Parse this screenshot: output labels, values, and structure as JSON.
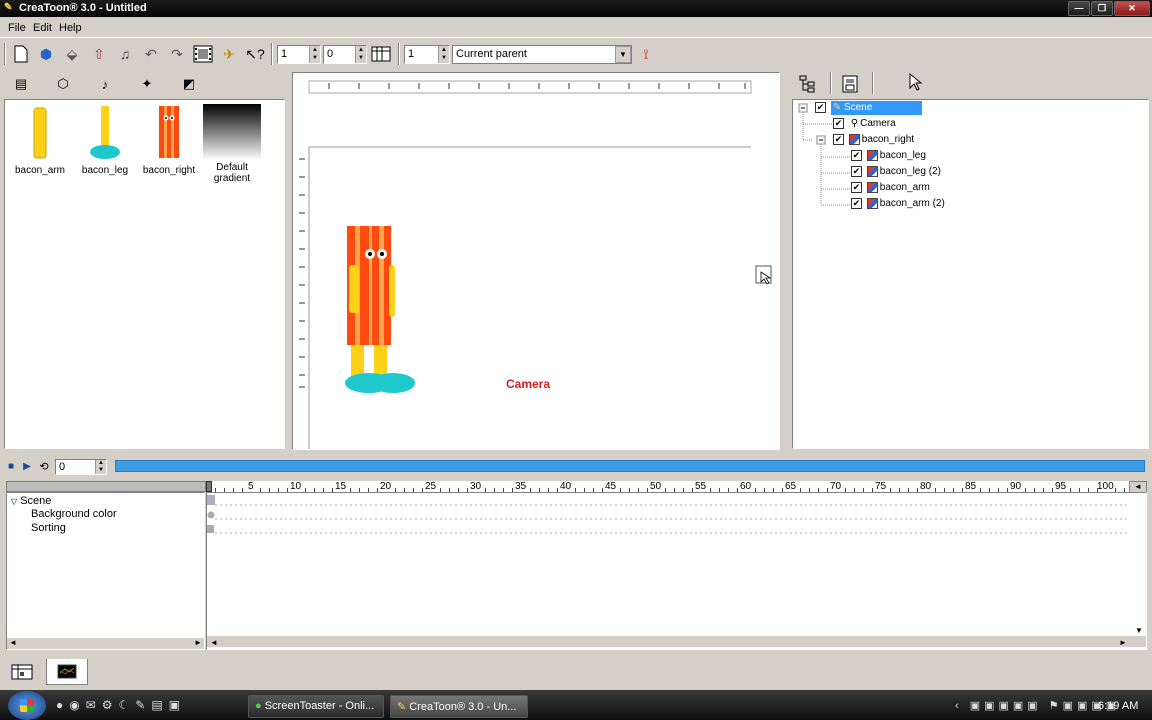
{
  "window": {
    "title": "CreaToon® 3.0 - Untitled"
  },
  "menu": {
    "file": "File",
    "edit": "Edit",
    "help": "Help"
  },
  "toolbar": {
    "frame_value_a": "1",
    "frame_value_b": "0",
    "layer_value": "1",
    "parent_select": "Current parent"
  },
  "library": {
    "items": [
      {
        "label": "bacon_arm"
      },
      {
        "label": "bacon_leg"
      },
      {
        "label": "bacon_right"
      },
      {
        "label": "Default gradient"
      }
    ]
  },
  "stage": {
    "camera_label": "Camera"
  },
  "tree": {
    "scene": "Scene",
    "camera": "Camera",
    "bacon_right": "bacon_right",
    "children": [
      "bacon_leg",
      "bacon_leg (2)",
      "bacon_arm",
      "bacon_arm (2)"
    ]
  },
  "timeline": {
    "frame_input": "0",
    "ticks": [
      "5",
      "10",
      "15",
      "20",
      "25",
      "30",
      "35",
      "40",
      "45",
      "50",
      "55",
      "60",
      "65",
      "70",
      "75",
      "80",
      "85",
      "90",
      "95",
      "100"
    ],
    "tracks": {
      "scene": "Scene",
      "background": "Background color",
      "sorting": "Sorting"
    }
  },
  "taskbar": {
    "task1": "ScreenToaster - Onli...",
    "task2": "CreaToon® 3.0 - Un...",
    "clock": "6:19 AM"
  },
  "colors": {
    "accent": "#3b9be3",
    "selection": "#3399ff",
    "camera_text": "#cc2222"
  }
}
